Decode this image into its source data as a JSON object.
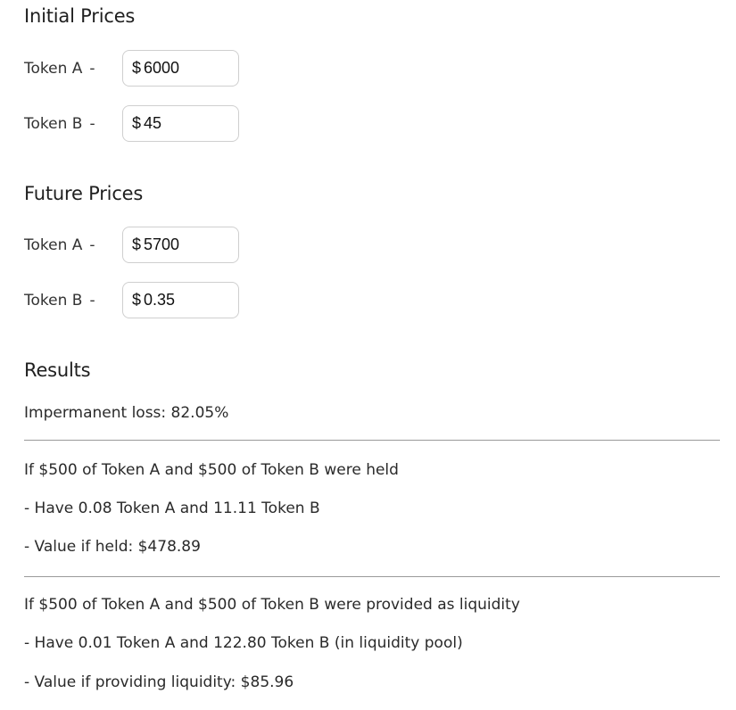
{
  "initial": {
    "title": "Initial Prices",
    "token_a": {
      "label": "Token A",
      "dash": "-",
      "currency": "$",
      "value": "6000"
    },
    "token_b": {
      "label": "Token B",
      "dash": "-",
      "currency": "$",
      "value": "45"
    }
  },
  "future": {
    "title": "Future Prices",
    "token_a": {
      "label": "Token A",
      "dash": "-",
      "currency": "$",
      "value": "5700"
    },
    "token_b": {
      "label": "Token B",
      "dash": "-",
      "currency": "$",
      "value": "0.35"
    }
  },
  "results": {
    "title": "Results",
    "impermanent_loss": "Impermanent loss: 82.05%",
    "held": {
      "heading": "If $500 of Token A and $500 of Token B were held",
      "have": "- Have 0.08 Token A and 11.11 Token B",
      "value": "- Value if held: $478.89"
    },
    "liquidity": {
      "heading": "If $500 of Token A and $500 of Token B were provided as liquidity",
      "have": "- Have 0.01 Token A and 122.80 Token B (in liquidity pool)",
      "value": "- Value if providing liquidity: $85.96"
    }
  }
}
